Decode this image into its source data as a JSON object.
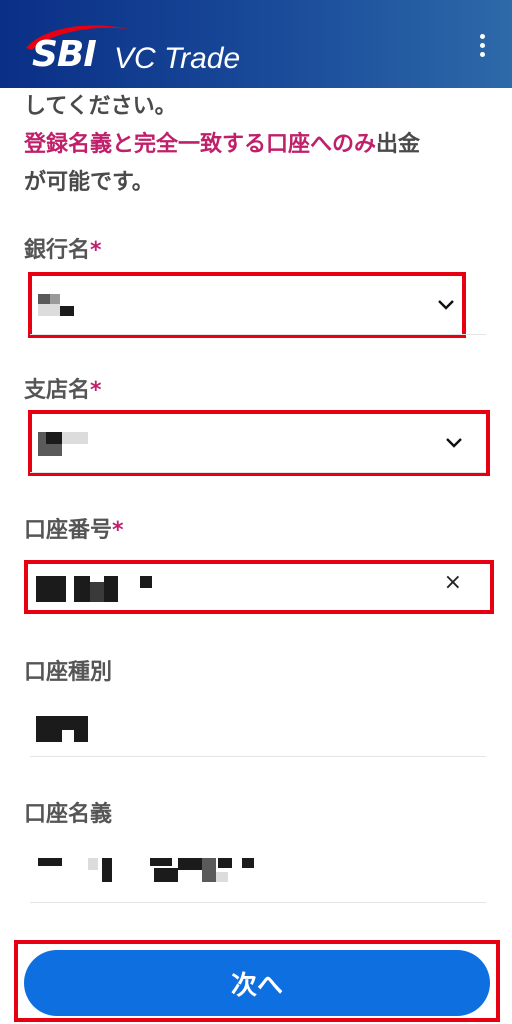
{
  "header": {
    "logo_sbi": "SBI",
    "logo_product": "VC Trade",
    "menu_icon": "kebab-menu-icon",
    "bg_color": "#0a2f86"
  },
  "notice": {
    "line1": "してください。",
    "line2_highlight": "登録名義と完全一致する口座へのみ",
    "line2_rest": "出金",
    "line3": "が可能です。",
    "highlight_color": "#c0206a"
  },
  "form": {
    "bank_name": {
      "label": "銀行名",
      "required_mark": "*",
      "icon": "chevron-down-icon"
    },
    "branch_name": {
      "label": "支店名",
      "required_mark": "*",
      "icon": "chevron-down-icon"
    },
    "account_number": {
      "label": "口座番号",
      "required_mark": "*",
      "clear_icon": "×"
    },
    "account_type": {
      "label": "口座種別"
    },
    "account_holder": {
      "label": "口座名義"
    }
  },
  "actions": {
    "next_label": "次へ",
    "button_color": "#0e6fe0",
    "highlight_color": "#e60012"
  }
}
